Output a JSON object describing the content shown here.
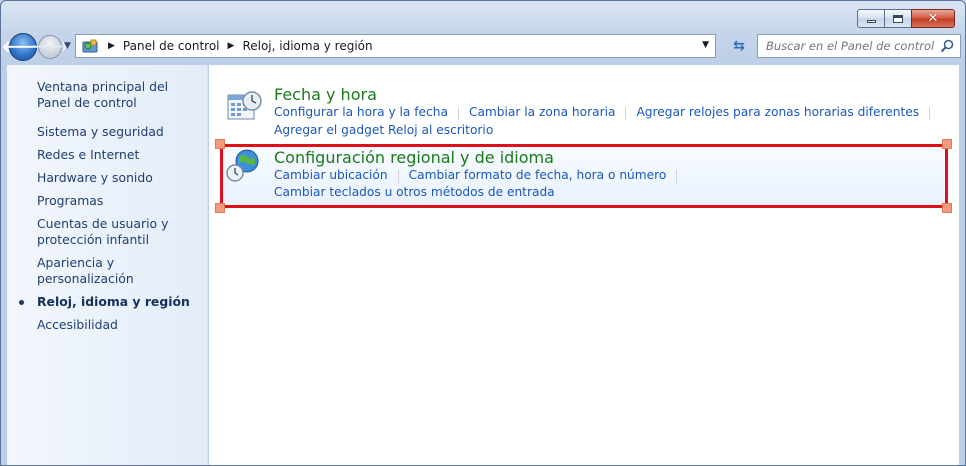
{
  "window": {
    "caption": {
      "minimize": "minimize",
      "maximize": "maximize",
      "close": "close"
    }
  },
  "navbar": {
    "breadcrumb": [
      "Panel de control",
      "Reloj, idioma y región"
    ],
    "search_placeholder": "Buscar en el Panel de control"
  },
  "sidebar": {
    "items": [
      {
        "label": "Ventana principal del Panel de control",
        "active": false
      },
      {
        "label": "Sistema y seguridad",
        "active": false
      },
      {
        "label": "Redes e Internet",
        "active": false
      },
      {
        "label": "Hardware y sonido",
        "active": false
      },
      {
        "label": "Programas",
        "active": false
      },
      {
        "label": "Cuentas de usuario y protección infantil",
        "active": false
      },
      {
        "label": "Apariencia y personalización",
        "active": false
      },
      {
        "label": "Reloj, idioma y región",
        "active": true
      },
      {
        "label": "Accesibilidad",
        "active": false
      }
    ]
  },
  "categories": [
    {
      "title": "Fecha y hora",
      "icon": "calendar-clock-icon",
      "links_row1": [
        "Configurar la hora y la fecha",
        "Cambiar la zona horaria",
        "Agregar relojes para zonas horarias diferentes"
      ],
      "links_row2": [
        "Agregar el gadget Reloj al escritorio"
      ]
    },
    {
      "title": "Configuración regional y de idioma",
      "icon": "globe-clock-icon",
      "links_row1": [
        "Cambiar ubicación",
        "Cambiar formato de fecha, hora o número"
      ],
      "links_row2": [
        "Cambiar teclados u otros métodos de entrada"
      ]
    }
  ],
  "colors": {
    "highlight_border": "#e0101a",
    "category_title": "#1b7a1b",
    "link": "#1b58b8"
  }
}
